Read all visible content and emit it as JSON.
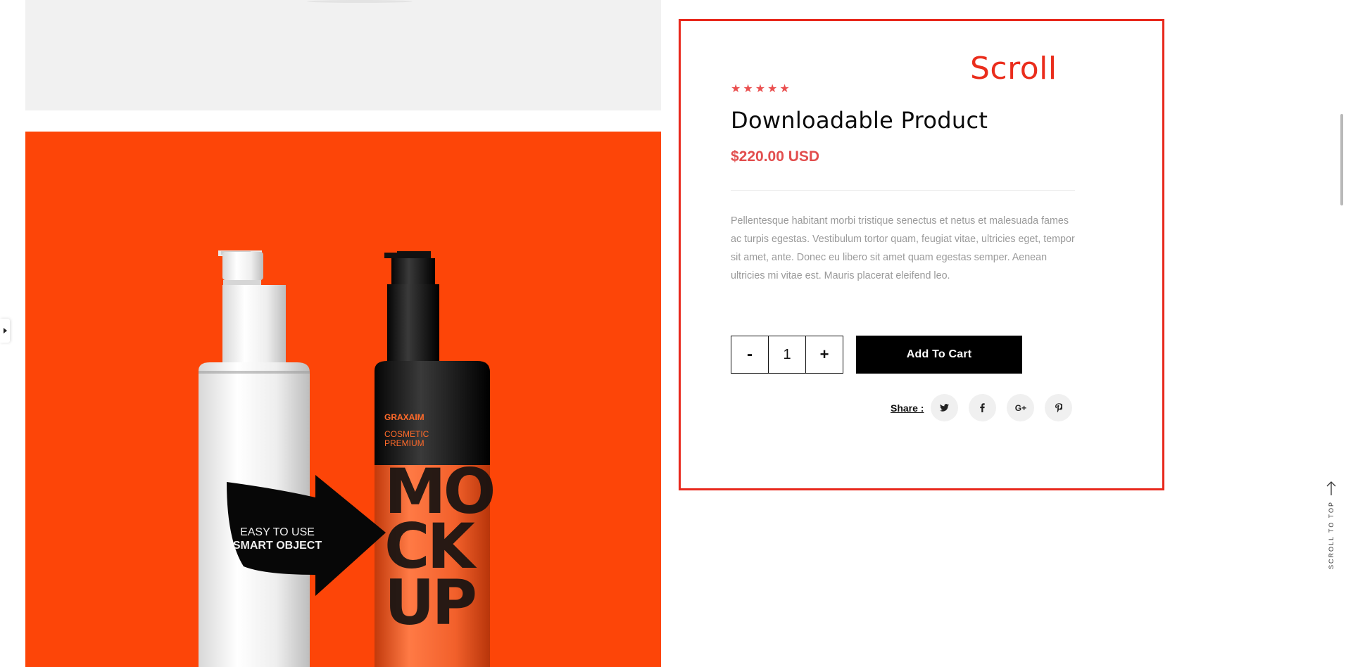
{
  "annotation": {
    "scroll_label": "Scroll"
  },
  "product": {
    "rating": 5,
    "title": "Downloadable Product",
    "price": "$220.00 USD",
    "description": "Pellentesque habitant morbi tristique senectus et netus et malesuada fames ac turpis egestas. Vestibulum tortor quam, feugiat vitae, ultricies eget, tempor sit amet, ante. Donec eu libero sit amet quam egestas semper. Aenean ultricies mi vitae est. Mauris placerat eleifend leo.",
    "quantity": "1",
    "minus_label": "-",
    "plus_label": "+",
    "add_to_cart_label": "Add To Cart",
    "share_label": "Share :",
    "share_networks": [
      "twitter-icon",
      "facebook-icon",
      "google-plus-icon",
      "pinterest-icon"
    ],
    "google_plus_text": "G+"
  },
  "gallery": {
    "main_image": {
      "brand_text": "GRAXAIM",
      "subtitle_text": "COSMETIC\nPREMIUM",
      "mock_text": [
        "MO",
        "CK",
        "UP"
      ],
      "arrow_text_line1": "EASY TO USE",
      "arrow_text_line2": "SMART OBJECT"
    }
  },
  "scroll_to_top": {
    "label": "SCROLL TO TOP"
  },
  "colors": {
    "accent_red": "#e24e4e",
    "annotation_red": "#e8281c",
    "image_orange": "#fd4508"
  }
}
